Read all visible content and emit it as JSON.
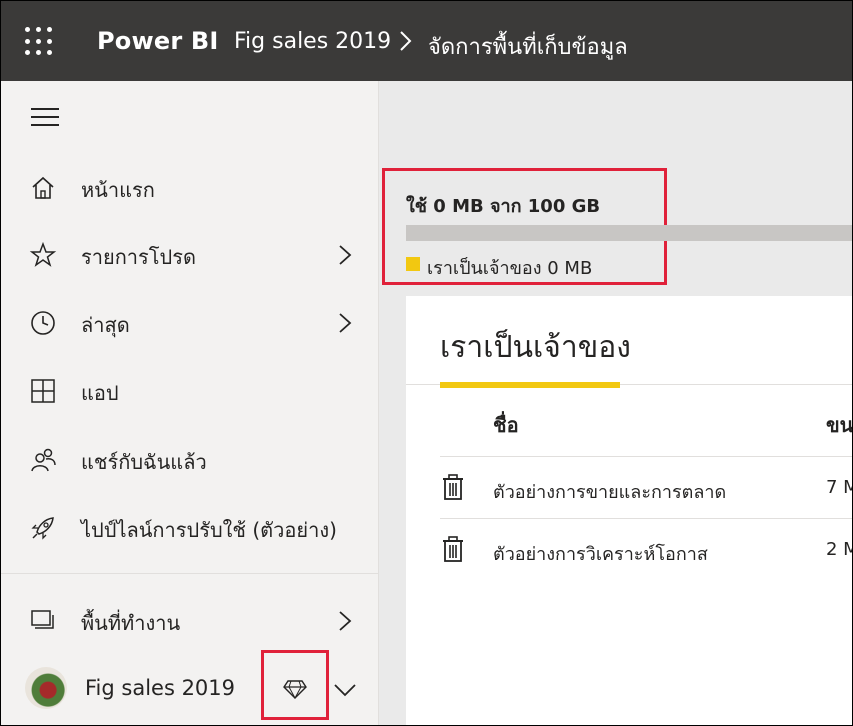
{
  "header": {
    "app_name": "Power BI",
    "breadcrumb": [
      "Fig sales 2019",
      "จัดการพื้นที่เก็บข้อมูล"
    ]
  },
  "sidebar": {
    "items": [
      {
        "label": "หน้าแรก",
        "icon": "home-icon",
        "has_chevron": false
      },
      {
        "label": "รายการโปรด",
        "icon": "star-icon",
        "has_chevron": true
      },
      {
        "label": "ล่าสุด",
        "icon": "clock-icon",
        "has_chevron": true
      },
      {
        "label": "แอป",
        "icon": "apps-icon",
        "has_chevron": false
      },
      {
        "label": "แชร์กับฉันแล้ว",
        "icon": "shared-icon",
        "has_chevron": false
      },
      {
        "label": "ไปป์ไลน์การปรับใช้ (ตัวอย่าง)",
        "icon": "rocket-icon",
        "has_chevron": false
      }
    ],
    "workspaces": {
      "label": "พื้นที่ทำงาน",
      "icon": "workspaces-icon"
    },
    "current_workspace": {
      "name": "Fig sales 2019",
      "badge_icon": "premium-diamond-icon"
    }
  },
  "storage": {
    "usage_text": "ใช้ 0 MB จาก 100 GB",
    "used_fraction": 0,
    "legend_label": "เราเป็นเจ้าของ 0 MB",
    "legend_color": "#f2c811"
  },
  "panel": {
    "tab_title": "เราเป็นเจ้าของ",
    "columns": {
      "name": "ชื่อ",
      "size": "ขน"
    },
    "rows": [
      {
        "name": "ตัวอย่างการขายและการตลาด",
        "size": "7 M"
      },
      {
        "name": "ตัวอย่างการวิเคราะห์โอกาส",
        "size": "2 M"
      }
    ]
  },
  "colors": {
    "accent": "#f2c811",
    "highlight": "#e0213a",
    "topbar": "#3b3a39"
  }
}
